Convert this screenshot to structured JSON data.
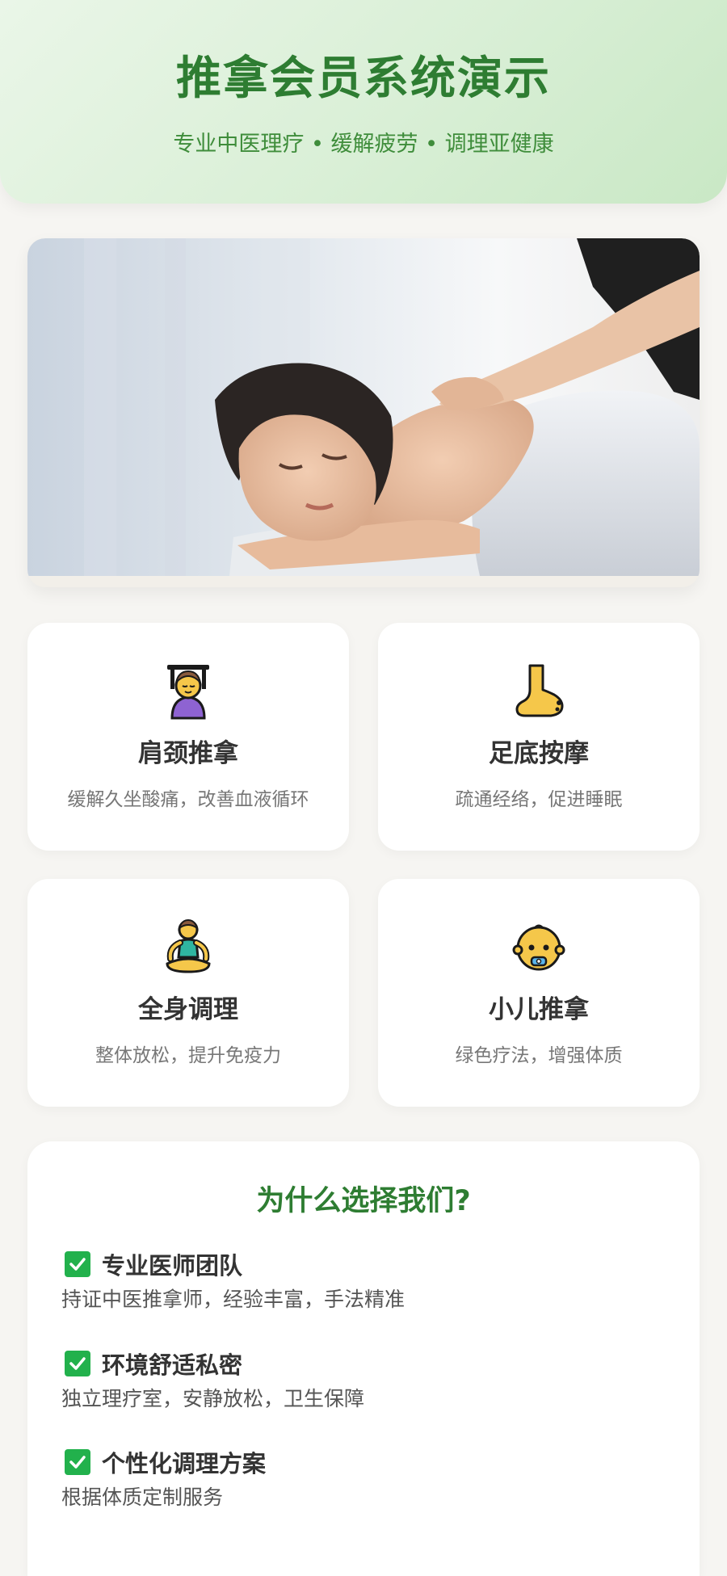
{
  "header": {
    "title": "推拿会员系统演示",
    "subtitle": "专业中医理疗 • 缓解疲劳 • 调理亚健康"
  },
  "colors": {
    "accent": "#2e7d32",
    "header_bg": "#dcefd9",
    "page_bg": "#f6f5f2",
    "check_green": "#22b14c"
  },
  "hero": {
    "icon": "massage-photo"
  },
  "services": [
    {
      "icon": "person-getting-massage-icon",
      "title": "肩颈推拿",
      "desc": "缓解久坐酸痛，改善血液循环"
    },
    {
      "icon": "foot-icon",
      "title": "足底按摩",
      "desc": "疏通经络，促进睡眠"
    },
    {
      "icon": "person-lotus-position-icon",
      "title": "全身调理",
      "desc": "整体放松，提升免疫力"
    },
    {
      "icon": "baby-icon",
      "title": "小儿推拿",
      "desc": "绿色疗法，增强体质"
    }
  ],
  "why": {
    "title": "为什么选择我们?",
    "items": [
      {
        "icon": "check-mark-icon",
        "label": "专业医师团队",
        "text": "持证中医推拿师，经验丰富，手法精准"
      },
      {
        "icon": "check-mark-icon",
        "label": "环境舒适私密",
        "text": "独立理疗室，安静放松，卫生保障"
      },
      {
        "icon": "check-mark-icon",
        "label": "个性化调理方案",
        "text": "根据体质定制服务"
      }
    ]
  }
}
